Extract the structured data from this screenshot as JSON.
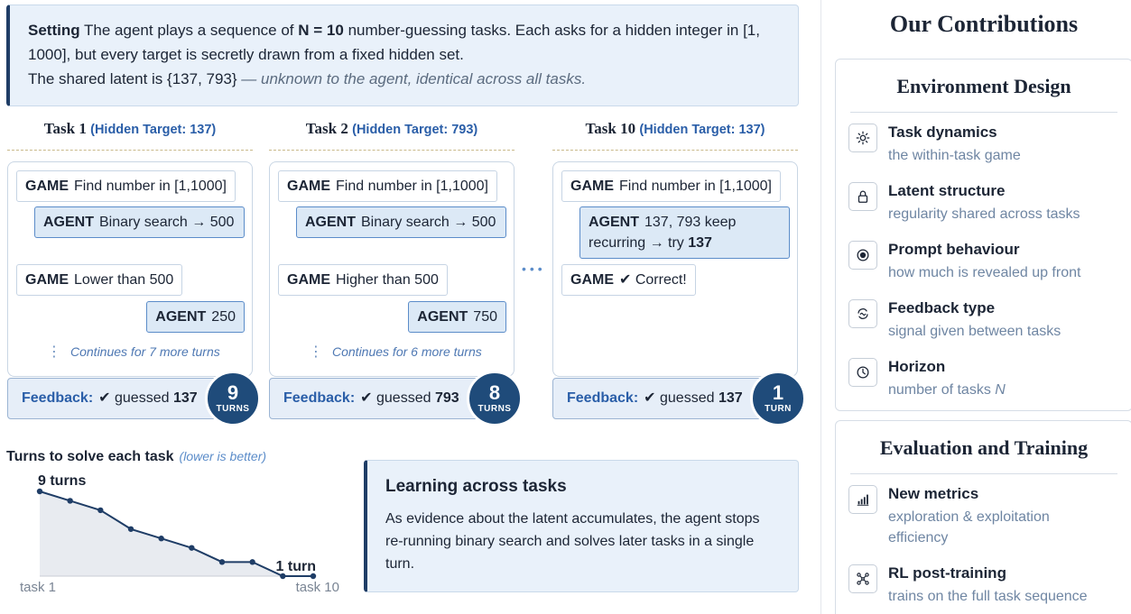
{
  "setting": {
    "label": "Setting",
    "text1": "The agent plays a sequence of",
    "n_label": "N = 10",
    "text2": "number-guessing tasks. Each asks for a hidden integer in [1, 1000], but every target is secretly drawn from a fixed hidden set.",
    "text3": "The shared latent is {137, 793}",
    "text3_em": "— unknown to the agent, identical across all tasks."
  },
  "tasks": [
    {
      "title": "Task 1",
      "sub": "(Hidden Target: 137)",
      "game1": "Find number in [1,1000]",
      "agent1": "Binary search → 500",
      "game2": "Lower than 500",
      "agent2": "250",
      "cont": "Continues for 7 more turns",
      "fb_label": "Feedback:",
      "fb_text": "✔ guessed",
      "fb_num": "137",
      "turns_n": "9",
      "turns_u": "TURNS"
    },
    {
      "title": "Task 2",
      "sub": "(Hidden Target: 793)",
      "game1": "Find number in [1,1000]",
      "agent1": "Binary search → 500",
      "game2": "Higher than 500",
      "agent2": "750",
      "cont": "Continues for 6 more turns",
      "fb_label": "Feedback:",
      "fb_text": "✔ guessed",
      "fb_num": "793",
      "turns_n": "8",
      "turns_u": "TURNS"
    },
    {
      "title": "Task 10",
      "sub": "(Hidden Target: 137)",
      "game1": "Find number in [1,1000]",
      "agent1a": "137, 793 keep recurring → try",
      "agent1b": "137",
      "game2": "✔ Correct!",
      "fb_label": "Feedback:",
      "fb_text": "✔ guessed",
      "fb_num": "137",
      "turns_n": "1",
      "turns_u": "TURN"
    }
  ],
  "tags": {
    "game": "GAME",
    "agent": "AGENT"
  },
  "chart_title": "Turns to solve each task",
  "chart_note": "(lower is better)",
  "chart_data": {
    "type": "area",
    "x": [
      1,
      2,
      3,
      4,
      5,
      6,
      7,
      8,
      9,
      10
    ],
    "values": [
      9,
      8,
      7,
      5,
      4,
      3,
      1.5,
      1.5,
      0,
      0
    ],
    "annotations": {
      "start": "9 turns",
      "end": "1 turn"
    },
    "xtick_start": "task 1",
    "xtick_end": "task 10",
    "colors": {
      "line": "#1f3d66",
      "fill": "#e8ebf0"
    }
  },
  "learn": {
    "title": "Learning across tasks",
    "text": "As evidence about the latent accumulates, the agent stops re-running binary search and solves later tasks in a single turn."
  },
  "contrib": {
    "title": "Our Contributions",
    "env": {
      "title": "Environment Design",
      "items": [
        {
          "icon": "sun-icon",
          "title": "Task dynamics",
          "desc": "the within-task game"
        },
        {
          "icon": "lock-icon",
          "title": "Latent structure",
          "desc": "regularity shared across tasks"
        },
        {
          "icon": "radio-target-icon",
          "title": "Prompt behaviour",
          "desc": "how much is revealed up front"
        },
        {
          "icon": "wave-cycle-icon",
          "title": "Feedback type",
          "desc": "signal given between tasks"
        },
        {
          "icon": "clock-icon",
          "title": "Horizon",
          "desc": "number of tasks",
          "desc_em": "N"
        }
      ]
    },
    "eval": {
      "title": "Evaluation and Training",
      "items": [
        {
          "icon": "bar-chart-icon",
          "title": "New metrics",
          "desc": "exploration & exploitation efficiency"
        },
        {
          "icon": "network-icon",
          "title": "RL post-training",
          "desc": "trains on the full task sequence"
        }
      ]
    }
  }
}
